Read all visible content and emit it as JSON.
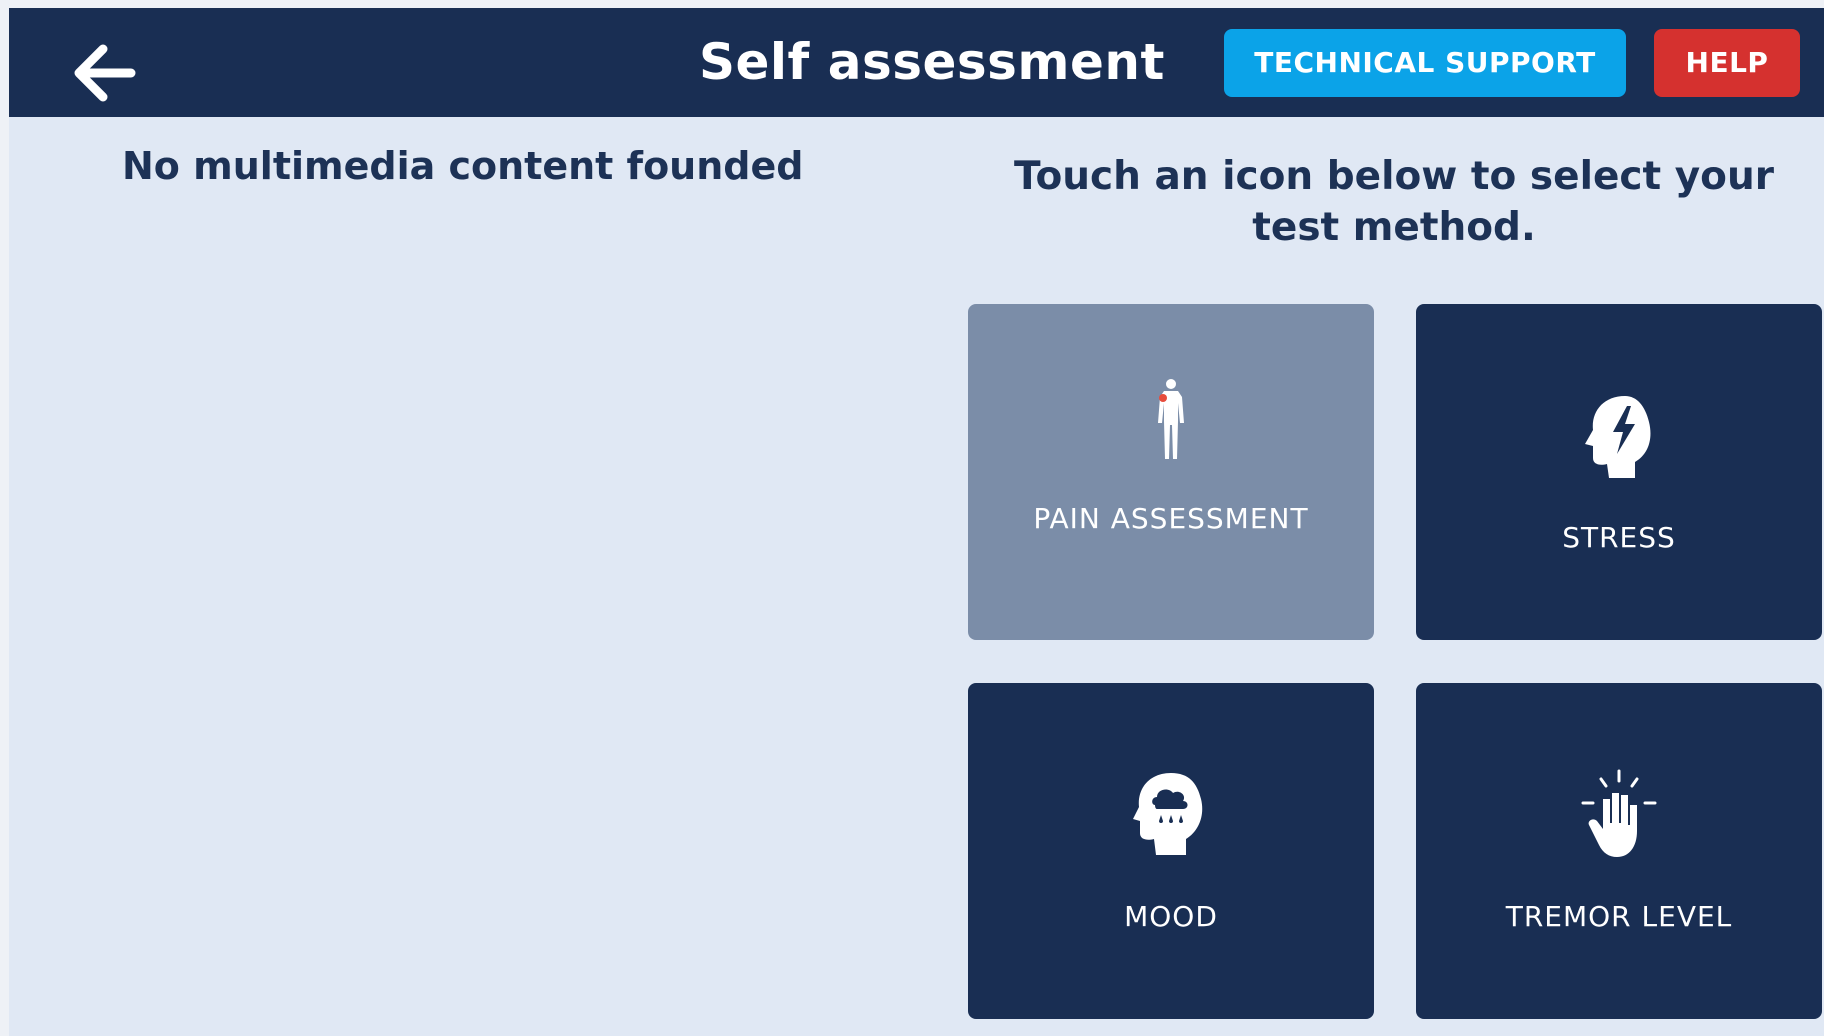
{
  "header": {
    "title": "Self assessment",
    "technical_support_label": "TECHNICAL SUPPORT",
    "help_label": "HELP",
    "back_icon": "arrow-left-icon"
  },
  "main": {
    "no_media_text": "No multimedia content founded",
    "instructions": "Touch an icon below to select your test method."
  },
  "methods": [
    {
      "label": "PAIN ASSESSMENT",
      "icon": "human-body-icon",
      "selected": true
    },
    {
      "label": "STRESS",
      "icon": "head-lightning-icon",
      "selected": false
    },
    {
      "label": "MOOD",
      "icon": "head-raincloud-icon",
      "selected": false
    },
    {
      "label": "TREMOR LEVEL",
      "icon": "shaking-hand-icon",
      "selected": false
    }
  ],
  "colors": {
    "header": "#192e53",
    "tile": "#192e53",
    "tile_selected": "#7b8da8",
    "technical_support": "#0ba3e8",
    "help": "#d5312f",
    "background": "#e0e8f4",
    "pain_marker": "#e74c3c"
  }
}
